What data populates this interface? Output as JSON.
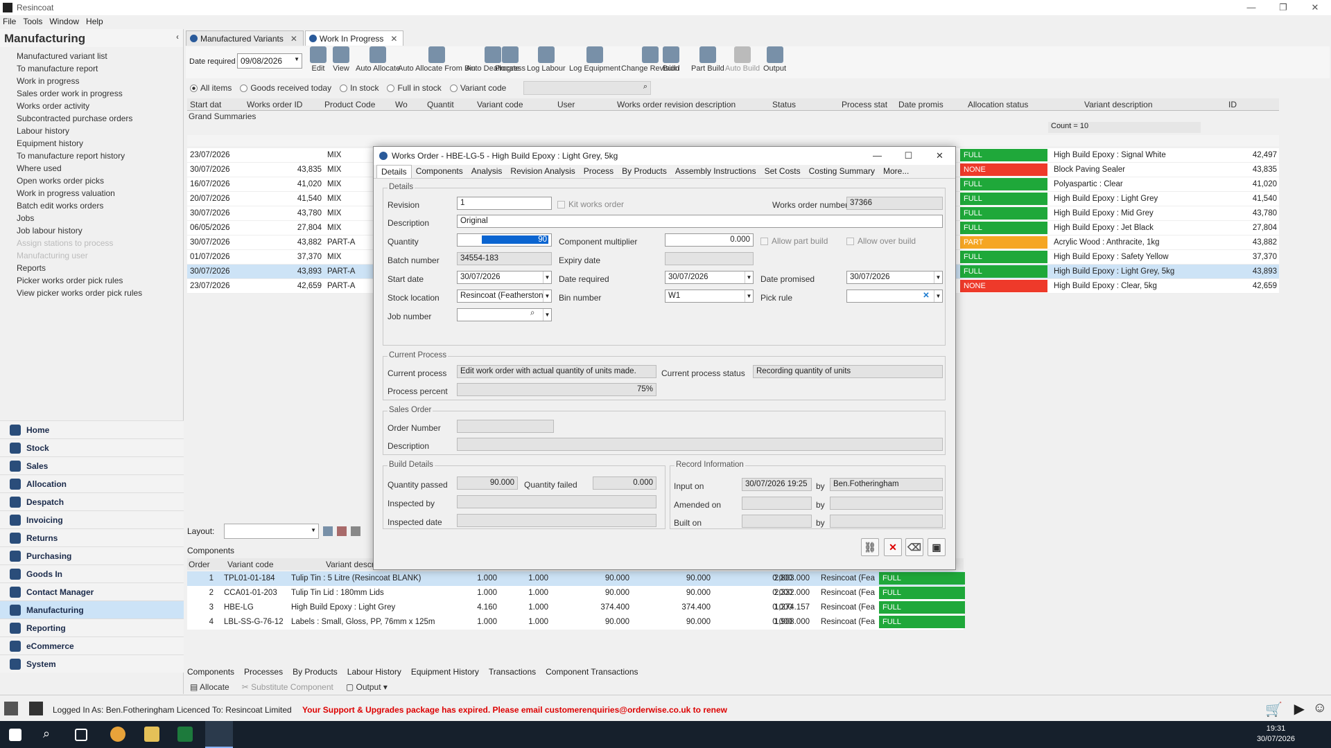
{
  "app": {
    "title": "Resincoat",
    "menu": [
      "File",
      "Tools",
      "Window",
      "Help"
    ]
  },
  "left_panel": {
    "title": "Manufacturing",
    "links": [
      {
        "label": "Manufactured variant list",
        "enabled": true
      },
      {
        "label": "To manufacture report",
        "enabled": true
      },
      {
        "label": "Work in progress",
        "enabled": true
      },
      {
        "label": "Sales order work in progress",
        "enabled": true
      },
      {
        "label": "Works order activity",
        "enabled": true
      },
      {
        "label": "Subcontracted purchase orders",
        "enabled": true
      },
      {
        "label": "Labour history",
        "enabled": true
      },
      {
        "label": "Equipment history",
        "enabled": true
      },
      {
        "label": "To manufacture report history",
        "enabled": true
      },
      {
        "label": "Where used",
        "enabled": true
      },
      {
        "label": "Open works order picks",
        "enabled": true
      },
      {
        "label": "Work in progress valuation",
        "enabled": true
      },
      {
        "label": "Batch edit works orders",
        "enabled": true
      },
      {
        "label": "Jobs",
        "enabled": true
      },
      {
        "label": "Job labour history",
        "enabled": true
      },
      {
        "label": "Assign stations to process",
        "enabled": false
      },
      {
        "label": "Manufacturing user",
        "enabled": false
      },
      {
        "label": "Reports",
        "enabled": true
      },
      {
        "label": "Picker works order pick rules",
        "enabled": true
      },
      {
        "label": "View picker works order pick rules",
        "enabled": true
      }
    ],
    "modules": [
      "Home",
      "Stock",
      "Sales",
      "Allocation",
      "Despatch",
      "Invoicing",
      "Returns",
      "Purchasing",
      "Goods In",
      "Contact Manager",
      "Manufacturing",
      "Reporting",
      "eCommerce",
      "System"
    ],
    "active_module": "Manufacturing"
  },
  "tabs": [
    "Manufactured Variants",
    "Work In Progress"
  ],
  "toolbar": {
    "date_required_label": "Date required",
    "date_required": "09/08/2026",
    "buttons": [
      "Edit",
      "View",
      "Auto Allocate",
      "Auto Allocate From Bin",
      "Auto Deallocate",
      "Progress",
      "Log Labour",
      "Log Equipment",
      "Change Revision",
      "Build",
      "Part Build",
      "Auto Build",
      "Output"
    ]
  },
  "filters": [
    "All items",
    "Goods received today",
    "In stock",
    "Full in stock",
    "Variant code"
  ],
  "grid": {
    "headers": [
      "Start dat",
      "Works order ID",
      "Product Code",
      "Wo",
      "Quantit",
      "Variant code",
      "User",
      "Works order revision description",
      "Status",
      "Process stat",
      "Date promis",
      "Allocation status",
      "Variant description",
      "ID"
    ],
    "grand_summaries": "Grand Summaries",
    "count": "Count = 10",
    "rows": [
      {
        "start": "23/07/2026",
        "wo": "",
        "code": "MIX",
        "status": "FULL",
        "desc": "High Build Epoxy : Signal White",
        "id": "42,497"
      },
      {
        "start": "30/07/2026",
        "wo": "43,835",
        "code": "MIX",
        "status": "NONE",
        "desc": "Block Paving Sealer",
        "id": "43,835"
      },
      {
        "start": "16/07/2026",
        "wo": "41,020",
        "code": "MIX",
        "status": "FULL",
        "desc": "Polyaspartic : Clear",
        "id": "41,020"
      },
      {
        "start": "20/07/2026",
        "wo": "41,540",
        "code": "MIX",
        "status": "FULL",
        "desc": "High Build Epoxy : Light Grey",
        "id": "41,540"
      },
      {
        "start": "30/07/2026",
        "wo": "43,780",
        "code": "MIX",
        "status": "FULL",
        "desc": "High Build Epoxy : Mid Grey",
        "id": "43,780"
      },
      {
        "start": "06/05/2026",
        "wo": "27,804",
        "code": "MIX",
        "status": "FULL",
        "desc": "High Build Epoxy : Jet Black",
        "id": "27,804"
      },
      {
        "start": "30/07/2026",
        "wo": "43,882",
        "code": "PART-A",
        "status": "PART",
        "desc": "Acrylic Wood : Anthracite, 1kg",
        "id": "43,882"
      },
      {
        "start": "01/07/2026",
        "wo": "37,370",
        "code": "MIX",
        "status": "FULL",
        "desc": "High Build Epoxy : Safety Yellow",
        "id": "37,370"
      },
      {
        "start": "30/07/2026",
        "wo": "43,893",
        "code": "PART-A",
        "status": "FULL",
        "desc": "High Build Epoxy : Light Grey, 5kg",
        "id": "43,893"
      },
      {
        "start": "23/07/2026",
        "wo": "42,659",
        "code": "PART-A",
        "status": "NONE",
        "desc": "High Build Epoxy : Clear, 5kg",
        "id": "42,659"
      }
    ]
  },
  "status_colors": {
    "FULL": "#1fa83a",
    "NONE": "#ee3a2a",
    "PART": "#f5a623"
  },
  "dialog": {
    "title": "Works Order - HBE-LG-5 - High Build Epoxy : Light Grey, 5kg",
    "tabs": [
      "Details",
      "Components",
      "Analysis",
      "Revision Analysis",
      "Process",
      "By Products",
      "Assembly Instructions",
      "Set Costs",
      "Costing Summary",
      "More..."
    ],
    "details_group": "Details",
    "revision_label": "Revision",
    "revision": "1",
    "kit_works_order": "Kit works order",
    "works_order_number_label": "Works order number",
    "works_order_number": "37366",
    "description_label": "Description",
    "description": "Original",
    "quantity_label": "Quantity",
    "quantity": "90",
    "component_multiplier_label": "Component multiplier",
    "component_multiplier": "0.000",
    "allow_part_build": "Allow part build",
    "allow_over_build": "Allow over build",
    "batch_number_label": "Batch number",
    "batch_number": "34554-183",
    "expiry_date_label": "Expiry date",
    "start_date_label": "Start date",
    "start_date": "30/07/2026",
    "date_required_label": "Date required",
    "date_required": "30/07/2026",
    "date_promised_label": "Date promised",
    "date_promised": "30/07/2026",
    "stock_location_label": "Stock location",
    "stock_location": "Resincoat (Featherston",
    "bin_number_label": "Bin number",
    "bin_number": "W1",
    "pick_rule_label": "Pick rule",
    "job_number_label": "Job number",
    "current_process_group": "Current Process",
    "current_process_label": "Current process",
    "current_process": "Edit work order with actual quantity of units made.",
    "current_process_status_label": "Current process status",
    "current_process_status": "Recording quantity of units",
    "process_percent_label": "Process percent",
    "process_percent": "75%",
    "sales_order_group": "Sales Order",
    "order_number_label": "Order Number",
    "so_description_label": "Description",
    "build_details_group": "Build Details",
    "quantity_passed_label": "Quantity passed",
    "quantity_passed": "90.000",
    "quantity_failed_label": "Quantity failed",
    "quantity_failed": "0.000",
    "inspected_by_label": "Inspected by",
    "inspected_date_label": "Inspected date",
    "record_info_group": "Record Information",
    "input_on_label": "Input on",
    "input_on": "30/07/2026 19:25",
    "by_label": "by",
    "input_by": "Ben.Fotheringham",
    "amended_on_label": "Amended on",
    "built_on_label": "Built on"
  },
  "layout_label": "Layout:",
  "components": {
    "title": "Components",
    "headers": [
      "Order",
      "Variant code",
      "Variant descr"
    ],
    "rows": [
      {
        "order": "1",
        "code": "TPL01-01-184",
        "desc": "Tulip Tin : 5 Litre (Resincoat BLANK)",
        "q1": "1.000",
        "q2": "1.000",
        "q3": "90.000",
        "q4": "90.000",
        "q5": "0.000",
        "q6": "2,803.000",
        "loc": "Resincoat (Fea",
        "status": "FULL"
      },
      {
        "order": "2",
        "code": "CCA01-01-203",
        "desc": "Tulip Tin Lid : 180mm Lids",
        "q1": "1.000",
        "q2": "1.000",
        "q3": "90.000",
        "q4": "90.000",
        "q5": "0.000",
        "q6": "2,332.000",
        "loc": "Resincoat (Fea",
        "status": "FULL"
      },
      {
        "order": "3",
        "code": "HBE-LG",
        "desc": "High Build Epoxy : Light Grey",
        "q1": "4.160",
        "q2": "1.000",
        "q3": "374.400",
        "q4": "374.400",
        "q5": "0.000",
        "q6": "1,274.157",
        "loc": "Resincoat (Fea",
        "status": "FULL"
      },
      {
        "order": "4",
        "code": "LBL-SS-G-76-12",
        "desc": "Labels : Small, Gloss, PP, 76mm x 125m",
        "q1": "1.000",
        "q2": "1.000",
        "q3": "90.000",
        "q4": "90.000",
        "q5": "0.000",
        "q6": "1,908.000",
        "loc": "Resincoat (Fea",
        "status": "FULL"
      }
    ]
  },
  "bottom_tabs": [
    "Components",
    "Processes",
    "By Products",
    "Labour History",
    "Equipment History",
    "Transactions",
    "Component Transactions"
  ],
  "bottom_actions": [
    "Allocate",
    "Substitute Component",
    "Output"
  ],
  "status_bar": {
    "logged_in": "Logged In As: Ben.Fotheringham  Licenced To: Resincoat Limited",
    "warning": "Your Support & Upgrades package has expired. Please email customerenquiries@orderwise.co.uk to renew"
  },
  "clock": {
    "time": "19:31",
    "date": "30/07/2026"
  }
}
